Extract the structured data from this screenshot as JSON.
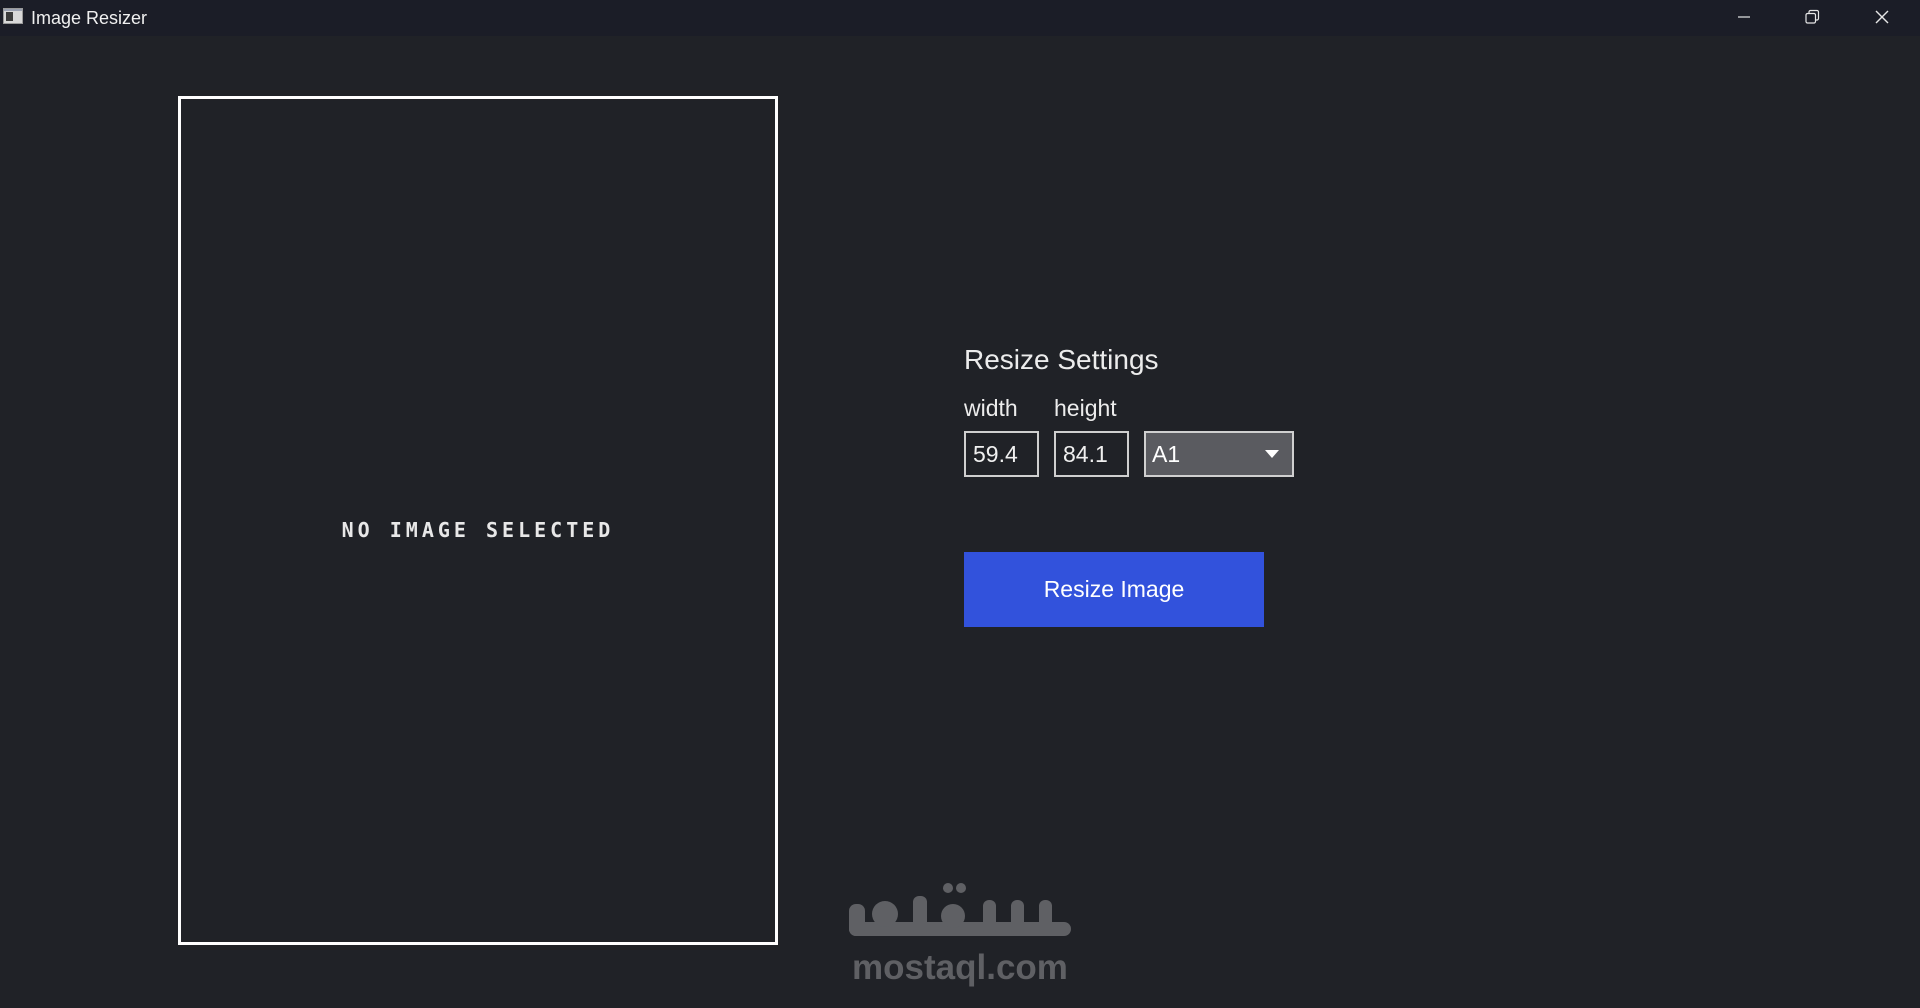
{
  "window": {
    "title": "Image Resizer",
    "icon": "app-window-icon",
    "controls": {
      "minimize_icon": "minimize-icon",
      "restore_icon": "restore-icon",
      "close_icon": "close-icon"
    }
  },
  "preview": {
    "placeholder": "NO IMAGE SELECTED"
  },
  "settings": {
    "title": "Resize Settings",
    "width_label": "width",
    "height_label": "height",
    "width_value": "59.4",
    "height_value": "84.1",
    "paper_size_selected": "A1",
    "resize_button_label": "Resize Image"
  },
  "watermark": {
    "text": "mostaql.com",
    "logo": "mostaql-logo"
  },
  "colors": {
    "background": "#202227",
    "titlebar": "#1b1d27",
    "accent_button": "#3252dc",
    "select_background": "#5a5b60",
    "watermark": "#5f6064"
  }
}
